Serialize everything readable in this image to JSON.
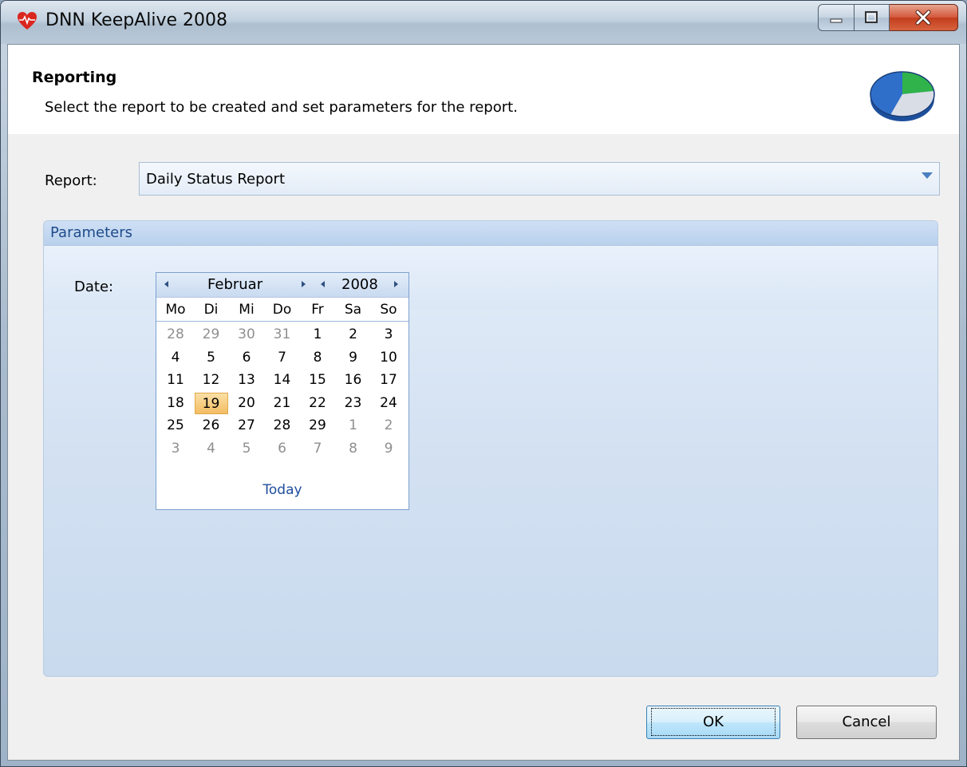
{
  "window": {
    "title": "DNN KeepAlive 2008",
    "icon": "heartbeat-icon"
  },
  "header": {
    "title": "Reporting",
    "description": "Select the report to be created and set parameters for the report.",
    "icon": "pie-chart-icon"
  },
  "report": {
    "label": "Report:",
    "selected": "Daily Status Report"
  },
  "parameters": {
    "title": "Parameters",
    "date_label": "Date:"
  },
  "calendar": {
    "month": "Februar",
    "year": "2008",
    "weekdays": [
      "Mo",
      "Di",
      "Mi",
      "Do",
      "Fr",
      "Sa",
      "So"
    ],
    "weeks": [
      [
        {
          "d": "28",
          "other": true
        },
        {
          "d": "29",
          "other": true
        },
        {
          "d": "30",
          "other": true
        },
        {
          "d": "31",
          "other": true
        },
        {
          "d": "1"
        },
        {
          "d": "2"
        },
        {
          "d": "3"
        }
      ],
      [
        {
          "d": "4"
        },
        {
          "d": "5"
        },
        {
          "d": "6"
        },
        {
          "d": "7"
        },
        {
          "d": "8"
        },
        {
          "d": "9"
        },
        {
          "d": "10"
        }
      ],
      [
        {
          "d": "11"
        },
        {
          "d": "12"
        },
        {
          "d": "13"
        },
        {
          "d": "14"
        },
        {
          "d": "15"
        },
        {
          "d": "16"
        },
        {
          "d": "17"
        }
      ],
      [
        {
          "d": "18"
        },
        {
          "d": "19",
          "selected": true
        },
        {
          "d": "20"
        },
        {
          "d": "21"
        },
        {
          "d": "22"
        },
        {
          "d": "23"
        },
        {
          "d": "24"
        }
      ],
      [
        {
          "d": "25"
        },
        {
          "d": "26"
        },
        {
          "d": "27"
        },
        {
          "d": "28"
        },
        {
          "d": "29"
        },
        {
          "d": "1",
          "other": true
        },
        {
          "d": "2",
          "other": true
        }
      ],
      [
        {
          "d": "3",
          "other": true
        },
        {
          "d": "4",
          "other": true
        },
        {
          "d": "5",
          "other": true
        },
        {
          "d": "6",
          "other": true
        },
        {
          "d": "7",
          "other": true
        },
        {
          "d": "8",
          "other": true
        },
        {
          "d": "9",
          "other": true
        }
      ]
    ],
    "today_label": "Today"
  },
  "buttons": {
    "ok": "OK",
    "cancel": "Cancel"
  },
  "colors": {
    "accent": "#1f4c9c",
    "selected_day": "#f3bd62",
    "close_button": "#c23d1c"
  }
}
